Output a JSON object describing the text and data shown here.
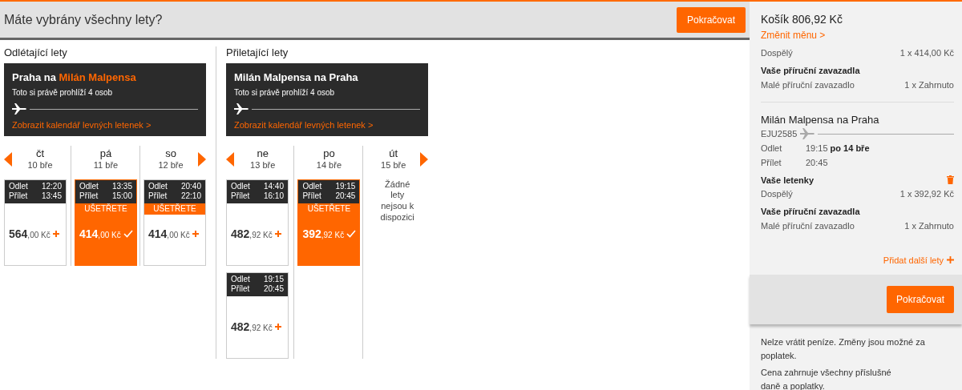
{
  "banner": {
    "question": "Máte vybrány všechny lety?",
    "button": "Pokračovat"
  },
  "legs": [
    {
      "heading": "Odlétající lety",
      "route": [
        {
          "text": "Praha na ",
          "highlight": false
        },
        {
          "text": "Milán Malpensa",
          "highlight": true
        }
      ],
      "viewers": "Toto si právě prohlíží 4 osob",
      "calendar_link": "Zobrazit kalendář levných letenek >",
      "days": [
        {
          "weekday": "čt",
          "date": "10 bře",
          "flights": [
            {
              "depart_label": "Odlet",
              "depart": "12:20",
              "arrive_label": "Přílet",
              "arrive": "13:45",
              "price": "564",
              "price_rest": ",00 Kč",
              "selected": false
            }
          ]
        },
        {
          "weekday": "pá",
          "date": "11 bře",
          "flights": [
            {
              "depart_label": "Odlet",
              "depart": "13:35",
              "arrive_label": "Přílet",
              "arrive": "15:00",
              "badge": "UŠETŘETE",
              "price": "414",
              "price_rest": ",00 Kč",
              "selected": true
            }
          ]
        },
        {
          "weekday": "so",
          "date": "12 bře",
          "flights": [
            {
              "depart_label": "Odlet",
              "depart": "20:40",
              "arrive_label": "Přílet",
              "arrive": "22:10",
              "badge": "UŠETŘETE",
              "price": "414",
              "price_rest": ",00 Kč",
              "selected": false
            }
          ]
        }
      ]
    },
    {
      "heading": "Přiletající lety",
      "route": [
        {
          "text": "Milán Malpensa na Praha",
          "highlight": false
        }
      ],
      "viewers": "Toto si právě prohlíží 4 osob",
      "calendar_link": "Zobrazit kalendář levných letenek >",
      "days": [
        {
          "weekday": "ne",
          "date": "13 bře",
          "flights": [
            {
              "depart_label": "Odlet",
              "depart": "14:40",
              "arrive_label": "Přílet",
              "arrive": "16:10",
              "price": "482",
              "price_rest": ",92 Kč",
              "selected": false
            },
            {
              "depart_label": "Odlet",
              "depart": "19:15",
              "arrive_label": "Přílet",
              "arrive": "20:45",
              "price": "482",
              "price_rest": ",92 Kč",
              "selected": false
            }
          ]
        },
        {
          "weekday": "po",
          "date": "14 bře",
          "flights": [
            {
              "depart_label": "Odlet",
              "depart": "19:15",
              "arrive_label": "Přílet",
              "arrive": "20:45",
              "badge": "UŠETŘETE",
              "price": "392",
              "price_rest": ",92 Kč",
              "selected": true
            }
          ]
        },
        {
          "weekday": "út",
          "date": "15 bře",
          "message": "Žádné lety nejsou k dispozici"
        }
      ]
    }
  ],
  "basket": {
    "title": "Košík 806,92 Kč",
    "currency_link": "Změnit měnu >",
    "segments": [
      {
        "groups": [
          {
            "rows": [
              {
                "label": "Dospělý",
                "value": "1 x 414,00 Kč"
              }
            ]
          },
          {
            "heading": "Vaše příruční zavazadla",
            "rows": [
              {
                "label": "Malé příruční zavazadlo",
                "value": "1 x Zahrnuto"
              }
            ]
          }
        ]
      },
      {
        "title": "Milán Malpensa na Praha",
        "flight_number": "EJU2585",
        "times": [
          {
            "label": "Odlet",
            "time": "19:15",
            "day": "po 14 bře"
          },
          {
            "label": "Přílet",
            "time": "20:45"
          }
        ],
        "groups": [
          {
            "heading": "Vaše letenky",
            "deletable": true,
            "rows": [
              {
                "label": "Dospělý",
                "value": "1 x 392,92 Kč"
              }
            ]
          },
          {
            "heading": "Vaše příruční zavazadla",
            "rows": [
              {
                "label": "Malé příruční zavazadlo",
                "value": "1 x Zahrnuto"
              }
            ]
          }
        ]
      }
    ],
    "add_link": "Přidat další lety",
    "button": "Pokračovat",
    "notes": [
      [
        {
          "text": "Nelze vrátit peníze. Změny jsou možné za ",
          "link": false
        },
        {
          "text": "poplatek",
          "link": true
        },
        {
          "text": ".",
          "link": false
        }
      ],
      [
        {
          "text": "Cena zahrnuje všechny příslušné ",
          "link": false
        },
        {
          "text": "daně a poplatky",
          "link": true
        },
        {
          "text": ".",
          "link": false
        }
      ]
    ]
  }
}
